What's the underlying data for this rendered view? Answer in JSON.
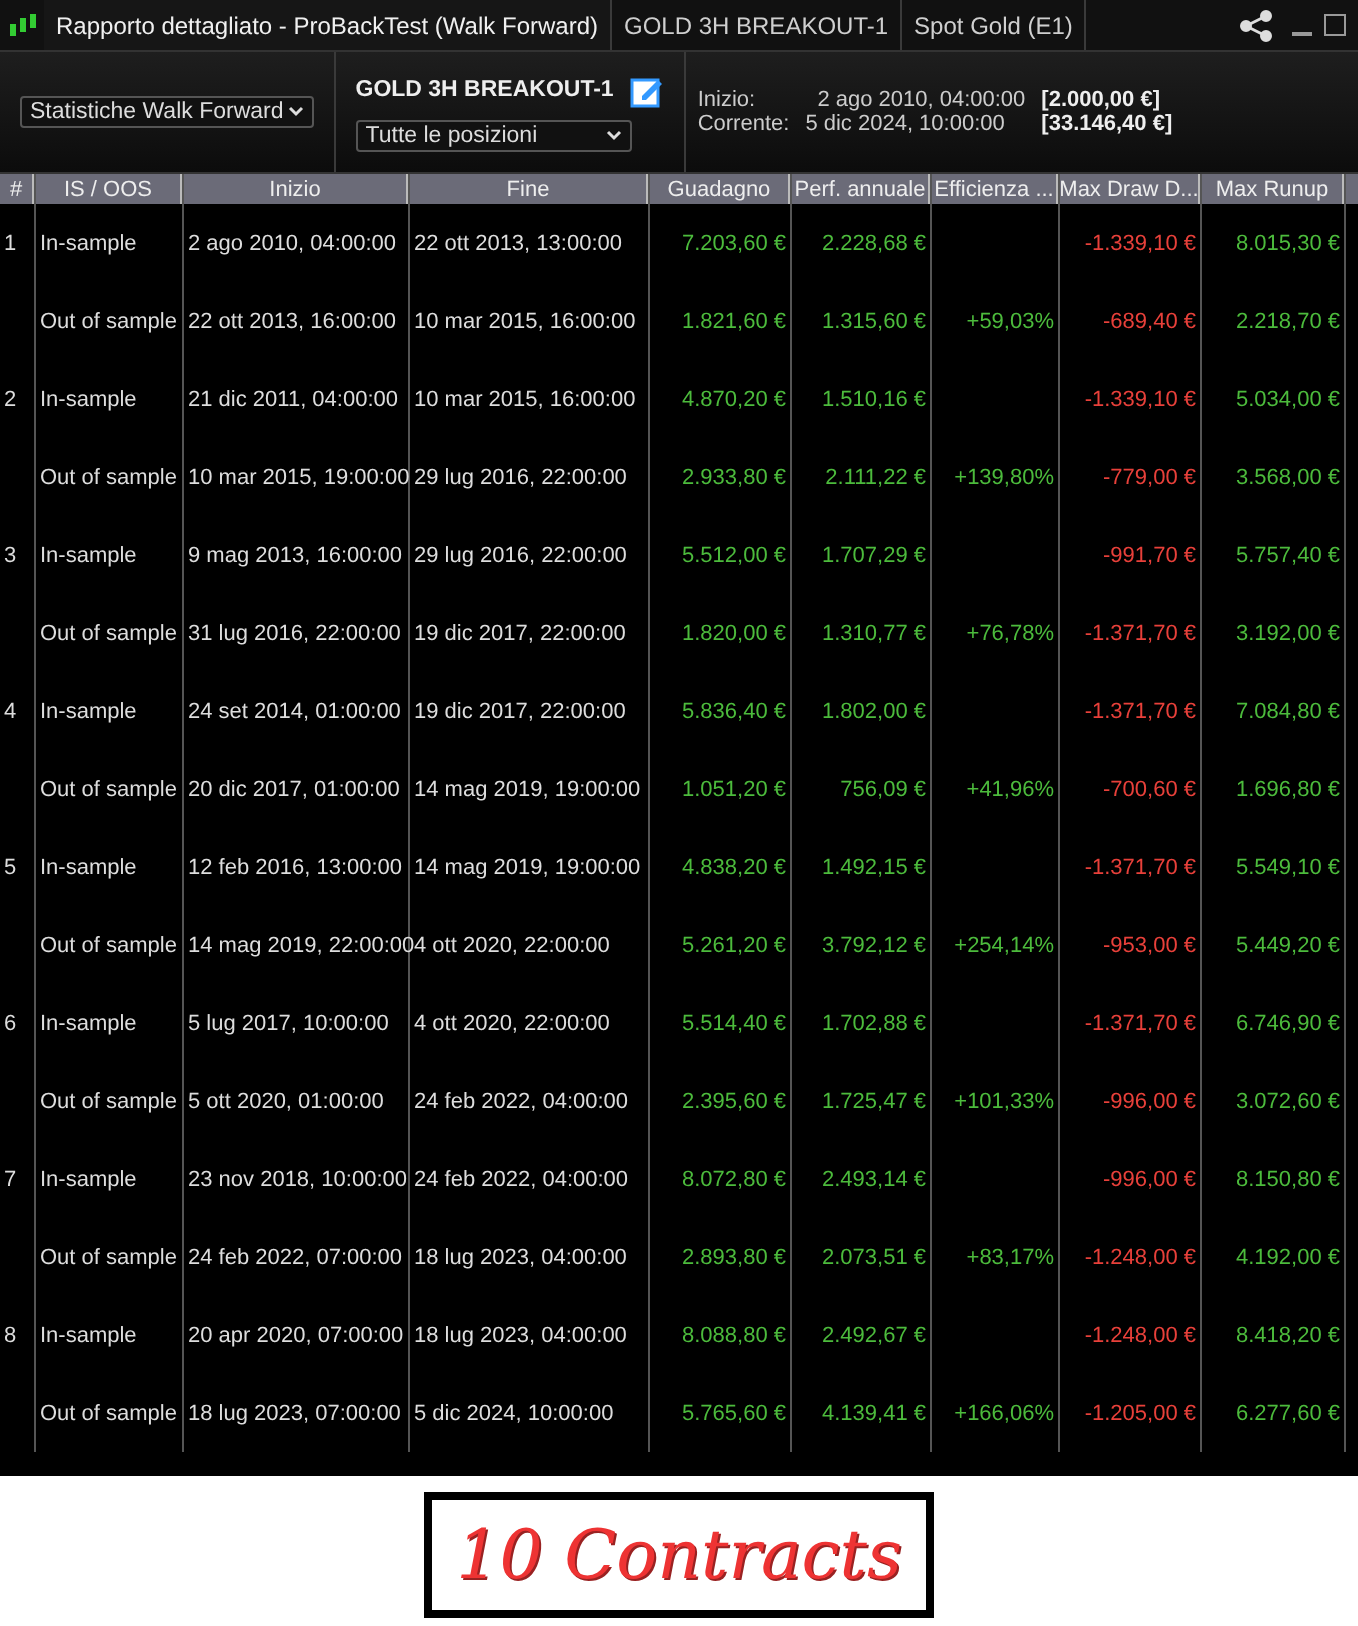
{
  "title_bar": {
    "tabs": [
      {
        "label": "Rapporto dettagliato - ProBackTest (Walk Forward)",
        "selected": true
      },
      {
        "label": "GOLD 3H BREAKOUT-1",
        "selected": false
      },
      {
        "label": "Spot Gold (E1)",
        "selected": false
      }
    ]
  },
  "toolbar": {
    "view_select": "Statistiche Walk Forward",
    "system_name": "GOLD 3H BREAKOUT-1",
    "positions_select": "Tutte le posizioni",
    "start_label": "Inizio:",
    "start_date": "2 ago 2010, 04:00:00",
    "start_value": "[2.000,00 €]",
    "current_label": "Corrente:",
    "current_date": "5 dic 2024, 10:00:00",
    "current_value": "[33.146,40 €]"
  },
  "table": {
    "columns": [
      {
        "label": "#"
      },
      {
        "label": "IS / OOS"
      },
      {
        "label": "Inizio"
      },
      {
        "label": "Fine"
      },
      {
        "label": "Guadagno",
        "color": "#4cbb3c"
      },
      {
        "label": "Perf. annuale",
        "color": "#4cbb3c"
      },
      {
        "label": "Efficienza ...",
        "color": "#4cbb3c"
      },
      {
        "label": "Max Draw D...",
        "color": "#e8403a"
      },
      {
        "label": "Max Runup",
        "color": "#4cbb3c"
      }
    ],
    "rows": [
      {
        "n": "1",
        "phase": "In-sample",
        "start": "2 ago 2010, 04:00:00",
        "end": "22 ott 2013, 13:00:00",
        "gain": "7.203,60 €",
        "annual": "2.228,68 €",
        "dd": "-1.339,10 €",
        "runup": "8.015,30 €"
      },
      {
        "phase": "Out of sample",
        "start": "22 ott 2013, 16:00:00",
        "end": "10 mar 2015, 16:00:00",
        "gain": "1.821,60 €",
        "annual": "1.315,60 €",
        "eff": "+59,03%",
        "dd": "-689,40 €",
        "runup": "2.218,70 €"
      },
      {
        "n": "2",
        "phase": "In-sample",
        "start": "21 dic 2011, 04:00:00",
        "end": "10 mar 2015, 16:00:00",
        "gain": "4.870,20 €",
        "annual": "1.510,16 €",
        "dd": "-1.339,10 €",
        "runup": "5.034,00 €"
      },
      {
        "phase": "Out of sample",
        "start": "10 mar 2015, 19:00:00",
        "end": "29 lug 2016, 22:00:00",
        "gain": "2.933,80 €",
        "annual": "2.111,22 €",
        "eff": "+139,80%",
        "dd": "-779,00 €",
        "runup": "3.568,00 €"
      },
      {
        "n": "3",
        "phase": "In-sample",
        "start": "9 mag 2013, 16:00:00",
        "end": "29 lug 2016, 22:00:00",
        "gain": "5.512,00 €",
        "annual": "1.707,29 €",
        "dd": "-991,70 €",
        "runup": "5.757,40 €"
      },
      {
        "phase": "Out of sample",
        "start": "31 lug 2016, 22:00:00",
        "end": "19 dic 2017, 22:00:00",
        "gain": "1.820,00 €",
        "annual": "1.310,77 €",
        "eff": "+76,78%",
        "dd": "-1.371,70 €",
        "runup": "3.192,00 €"
      },
      {
        "n": "4",
        "phase": "In-sample",
        "start": "24 set 2014, 01:00:00",
        "end": "19 dic 2017, 22:00:00",
        "gain": "5.836,40 €",
        "annual": "1.802,00 €",
        "dd": "-1.371,70 €",
        "runup": "7.084,80 €"
      },
      {
        "phase": "Out of sample",
        "start": "20 dic 2017, 01:00:00",
        "end": "14 mag 2019, 19:00:00",
        "gain": "1.051,20 €",
        "annual": "756,09 €",
        "eff": "+41,96%",
        "dd": "-700,60 €",
        "runup": "1.696,80 €"
      },
      {
        "n": "5",
        "phase": "In-sample",
        "start": "12 feb 2016, 13:00:00",
        "end": "14 mag 2019, 19:00:00",
        "gain": "4.838,20 €",
        "annual": "1.492,15 €",
        "dd": "-1.371,70 €",
        "runup": "5.549,10 €"
      },
      {
        "phase": "Out of sample",
        "start": "14 mag 2019, 22:00:00",
        "end": "4 ott 2020, 22:00:00",
        "gain": "5.261,20 €",
        "annual": "3.792,12 €",
        "eff": "+254,14%",
        "dd": "-953,00 €",
        "runup": "5.449,20 €"
      },
      {
        "n": "6",
        "phase": "In-sample",
        "start": "5 lug 2017, 10:00:00",
        "end": "4 ott 2020, 22:00:00",
        "gain": "5.514,40 €",
        "annual": "1.702,88 €",
        "dd": "-1.371,70 €",
        "runup": "6.746,90 €"
      },
      {
        "phase": "Out of sample",
        "start": "5 ott 2020, 01:00:00",
        "end": "24 feb 2022, 04:00:00",
        "gain": "2.395,60 €",
        "annual": "1.725,47 €",
        "eff": "+101,33%",
        "dd": "-996,00 €",
        "runup": "3.072,60 €"
      },
      {
        "n": "7",
        "phase": "In-sample",
        "start": "23 nov 2018, 10:00:00",
        "end": "24 feb 2022, 04:00:00",
        "gain": "8.072,80 €",
        "annual": "2.493,14 €",
        "dd": "-996,00 €",
        "runup": "8.150,80 €"
      },
      {
        "phase": "Out of sample",
        "start": "24 feb 2022, 07:00:00",
        "end": "18 lug 2023, 04:00:00",
        "gain": "2.893,80 €",
        "annual": "2.073,51 €",
        "eff": "+83,17%",
        "dd": "-1.248,00 €",
        "runup": "4.192,00 €"
      },
      {
        "n": "8",
        "phase": "In-sample",
        "start": "20 apr 2020, 07:00:00",
        "end": "18 lug 2023, 04:00:00",
        "gain": "8.088,80 €",
        "annual": "2.492,67 €",
        "dd": "-1.248,00 €",
        "runup": "8.418,20 €"
      },
      {
        "phase": "Out of sample",
        "start": "18 lug 2023, 07:00:00",
        "end": "5 dic 2024, 10:00:00",
        "gain": "5.765,60 €",
        "annual": "4.139,41 €",
        "eff": "+166,06%",
        "dd": "-1.205,00 €",
        "runup": "6.277,60 €"
      }
    ]
  },
  "caption": "10 Contracts"
}
